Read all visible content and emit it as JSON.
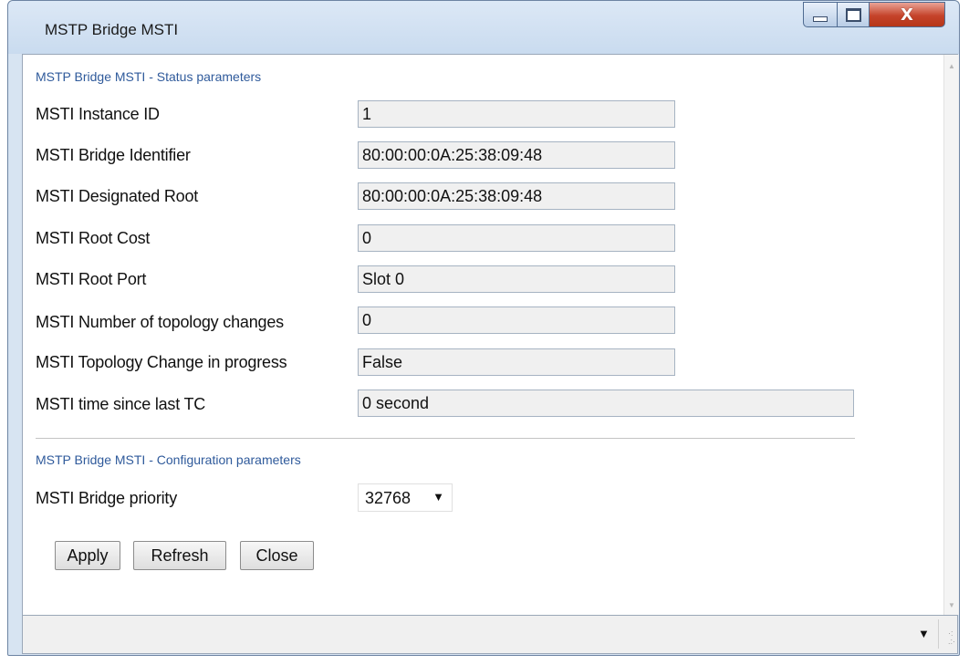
{
  "window": {
    "title": "MSTP Bridge MSTI",
    "controls": {
      "minimize_icon": "minimize-icon",
      "maximize_icon": "maximize-icon",
      "close_icon": "close-icon",
      "close_glyph": "X"
    }
  },
  "status_section": {
    "header": "MSTP Bridge MSTI - Status parameters",
    "fields": [
      {
        "label": "MSTI Instance ID",
        "value": "1"
      },
      {
        "label": "MSTI Bridge Identifier",
        "value": "80:00:00:0A:25:38:09:48"
      },
      {
        "label": "MSTI Designated Root",
        "value": "80:00:00:0A:25:38:09:48"
      },
      {
        "label": "MSTI Root Cost",
        "value": "0"
      },
      {
        "label": "MSTI Root Port",
        "value": "Slot 0"
      },
      {
        "label": "MSTI Number of topology changes",
        "value": "0"
      },
      {
        "label": "MSTI Topology Change in progress",
        "value": "False"
      },
      {
        "label": "MSTI time since last TC",
        "value": "0 second"
      }
    ]
  },
  "config_section": {
    "header": "MSTP Bridge MSTI - Configuration parameters",
    "bridge_priority": {
      "label": "MSTI Bridge priority",
      "value": "32768"
    }
  },
  "buttons": {
    "apply": "Apply",
    "refresh": "Refresh",
    "close": "Close"
  },
  "colors": {
    "section_header": "#2f5a9b",
    "close_button": "#c5432a",
    "frame": "#d7e4f2"
  }
}
